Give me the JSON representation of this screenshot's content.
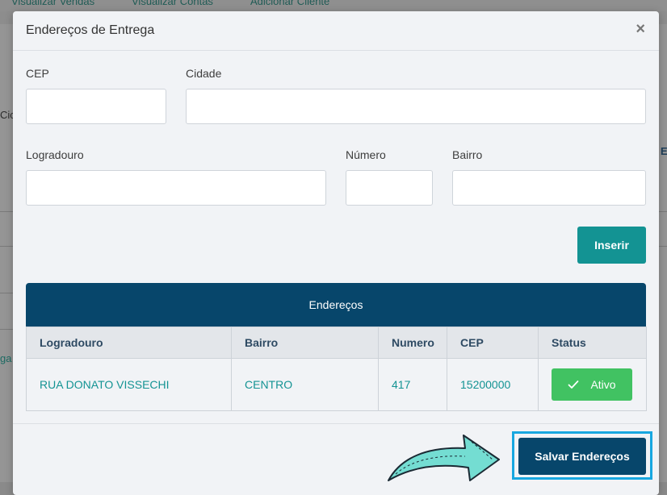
{
  "background": {
    "top_links": [
      "Visualizar Vendas",
      "Visualizar Contas",
      "Adicionar Cliente"
    ],
    "left_fragments": [
      "Cic",
      "ga"
    ],
    "right_fragments": [
      "E"
    ]
  },
  "modal": {
    "title": "Endereços de Entrega",
    "close_symbol": "×"
  },
  "form": {
    "cep_label": "CEP",
    "cidade_label": "Cidade",
    "logradouro_label": "Logradouro",
    "numero_label": "Número",
    "bairro_label": "Bairro",
    "cep_value": "",
    "cidade_value": "",
    "logradouro_value": "",
    "numero_value": "",
    "bairro_value": "",
    "insert_label": "Inserir"
  },
  "table": {
    "title": "Endereços",
    "columns": [
      "Logradouro",
      "Bairro",
      "Numero",
      "CEP",
      "Status"
    ],
    "rows": [
      {
        "logradouro": "RUA DONATO VISSECHI",
        "bairro": "CENTRO",
        "numero": "417",
        "cep": "15200000",
        "status": "Ativo"
      }
    ]
  },
  "footer": {
    "save_label": "Salvar Endereços"
  },
  "colors": {
    "primary": "#07466b",
    "teal": "#139393",
    "success": "#41c262",
    "highlight": "#17a7e0"
  },
  "icons": {
    "check": "check-icon",
    "close": "close-icon",
    "arrow": "pointer-arrow-icon"
  }
}
